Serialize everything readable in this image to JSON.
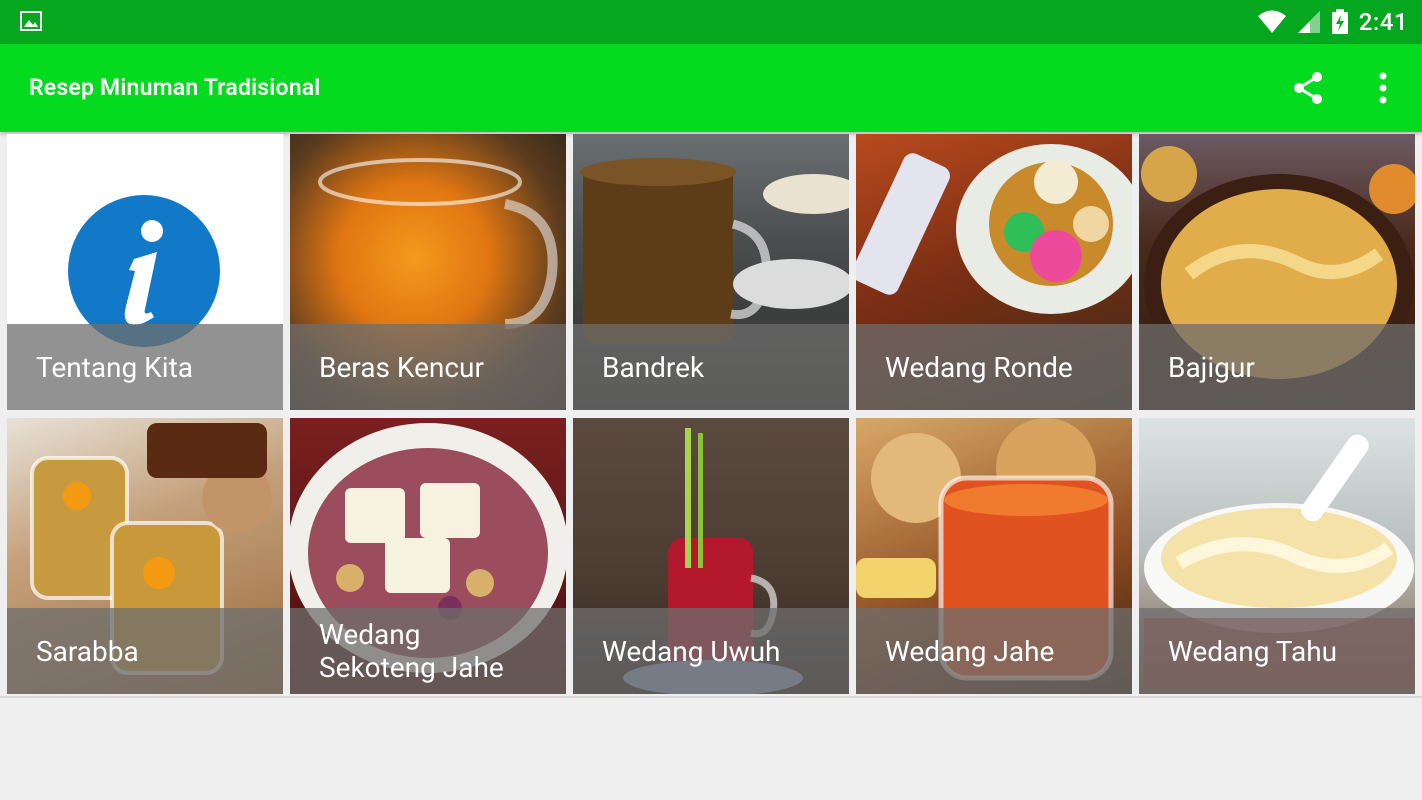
{
  "status_bar": {
    "time": "2:41",
    "icons": [
      "image-notification-icon",
      "wifi-icon",
      "cell-signal-icon",
      "battery-charging-icon"
    ]
  },
  "app_bar": {
    "title": "Resep Minuman Tradisional",
    "actions": [
      "share-icon",
      "more-vert-icon"
    ],
    "color": "#04db1f"
  },
  "grid": {
    "items": [
      {
        "label": "Tentang Kita"
      },
      {
        "label": "Beras Kencur"
      },
      {
        "label": "Bandrek"
      },
      {
        "label": "Wedang Ronde"
      },
      {
        "label": "Bajigur"
      },
      {
        "label": "Sarabba"
      },
      {
        "label": "Wedang Sekoteng Jahe"
      },
      {
        "label": "Wedang Uwuh"
      },
      {
        "label": "Wedang Jahe"
      },
      {
        "label": "Wedang Tahu"
      }
    ]
  }
}
